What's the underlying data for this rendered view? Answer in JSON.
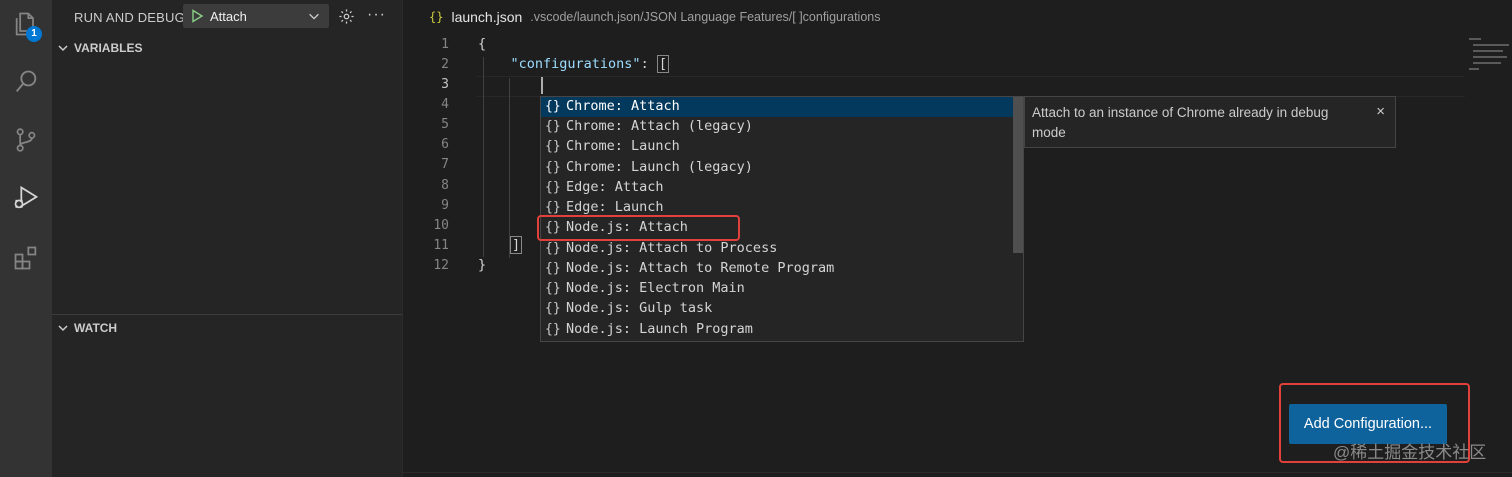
{
  "activity_bar": {
    "items": [
      {
        "icon": "files-icon",
        "badge": "1"
      },
      {
        "icon": "search-icon"
      },
      {
        "icon": "source-control-icon"
      },
      {
        "icon": "run-debug-icon"
      },
      {
        "icon": "extensions-icon"
      }
    ],
    "accent": "#0078d4"
  },
  "sidebar": {
    "title": "RUN AND DEBUG",
    "debug_config": "Attach",
    "more_label": "···",
    "sections": [
      {
        "label": "VARIABLES"
      },
      {
        "label": "WATCH"
      }
    ]
  },
  "editor": {
    "breadcrumb_icon": "{}",
    "file_name": "launch.json",
    "breadcrumb_path": ".vscode/launch.json/JSON Language Features/[ ]configurations",
    "line_numbers": [
      "1",
      "2",
      "3",
      "4",
      "5",
      "6",
      "7",
      "8",
      "9",
      "10",
      "11",
      "12"
    ],
    "current_line": "3",
    "code": {
      "l1": "{",
      "l2_key": "\"configurations\"",
      "l2_sep": ": ",
      "l2_bracket": "[",
      "l11": "]",
      "l12": "}"
    }
  },
  "suggest": {
    "icon": "{}",
    "items": [
      "Chrome: Attach",
      "Chrome: Attach (legacy)",
      "Chrome: Launch",
      "Chrome: Launch (legacy)",
      "Edge: Attach",
      "Edge: Launch",
      "Node.js: Attach",
      "Node.js: Attach to Process",
      "Node.js: Attach to Remote Program",
      "Node.js: Electron Main",
      "Node.js: Gulp task",
      "Node.js: Launch Program"
    ],
    "selected_index": 0,
    "highlighted_item": "Node.js: Attach",
    "details": "Attach to an instance of Chrome already in debug mode",
    "close_glyph": "×"
  },
  "add_configuration_button": "Add Configuration...",
  "watermark": "@稀土掘金技术社区",
  "colors": {
    "highlight_box": "#e0413b",
    "button": "#0e639c",
    "selection": "#04395e",
    "json_key": "#9cdcfe",
    "run_icon": "#89d185"
  }
}
